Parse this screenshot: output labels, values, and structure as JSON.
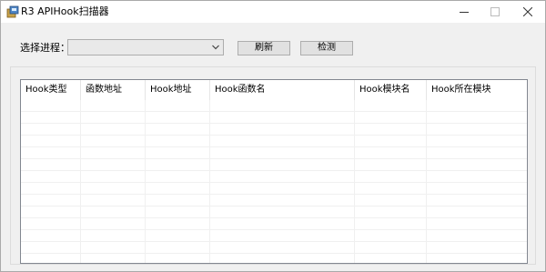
{
  "window": {
    "title": "R3 APIHook扫描器",
    "icon": "app-icon"
  },
  "controls": {
    "process_label": "选择进程：",
    "process_select_value": "",
    "refresh_label": "刷新",
    "detect_label": "检测"
  },
  "table": {
    "columns": [
      "Hook类型",
      "函数地址",
      "Hook地址",
      "Hook函数名",
      "Hook模块名",
      "Hook所在模块"
    ],
    "rows": []
  },
  "colors": {
    "window_bg": "#f0f0f0",
    "list_bg": "#ffffff",
    "button_bg": "#e1e1e1",
    "border": "#adadad"
  }
}
